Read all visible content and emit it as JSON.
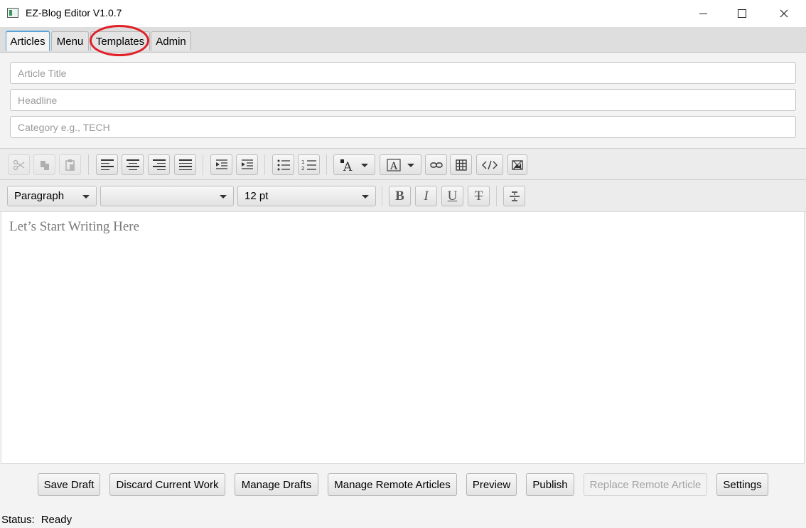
{
  "window": {
    "title": "EZ-Blog Editor V1.0.7",
    "controls": [
      "minimize-icon",
      "maximize-icon",
      "close-icon"
    ]
  },
  "tabs": [
    {
      "label": "Articles",
      "active": true
    },
    {
      "label": "Menu",
      "active": false
    },
    {
      "label": "Templates",
      "active": false,
      "highlighted": true
    },
    {
      "label": "Admin",
      "active": false
    }
  ],
  "fields": {
    "title_placeholder": "Article Title",
    "headline_placeholder": "Headline",
    "category_placeholder": "Category e.g., TECH"
  },
  "toolbar": {
    "paragraph_style": "Paragraph",
    "font_family": "",
    "font_size": "12 pt"
  },
  "editor": {
    "placeholder": "Let’s Start Writing Here"
  },
  "buttons": {
    "save_draft": "Save Draft",
    "discard": "Discard Current Work",
    "manage_drafts": "Manage Drafts",
    "manage_remote": "Manage Remote Articles",
    "preview": "Preview",
    "publish": "Publish",
    "replace_remote": "Replace Remote Article",
    "settings": "Settings"
  },
  "status": {
    "label": "Status:",
    "value": "Ready"
  },
  "colors": {
    "annotation": "#e01f26",
    "active_tab_accent": "#58a4d8"
  }
}
